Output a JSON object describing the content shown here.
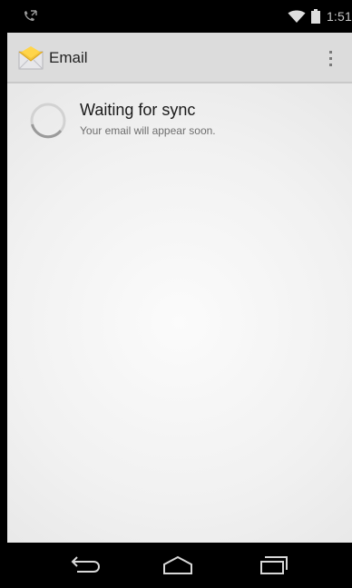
{
  "status_bar": {
    "time": "1:51",
    "icons": [
      "call-icon",
      "wifi-icon",
      "battery-icon"
    ]
  },
  "action_bar": {
    "title": "Email",
    "app_icon": "email-app-icon",
    "overflow_icon": "overflow-menu-icon"
  },
  "sync": {
    "title": "Waiting for sync",
    "subtitle": "Your email will appear soon.",
    "icon": "spinner-icon"
  },
  "nav_bar": {
    "buttons": [
      "back-icon",
      "home-icon",
      "recents-icon"
    ]
  },
  "colors": {
    "action_bar": "#dcdcdc",
    "status_bar": "#000000",
    "nav_bar": "#000000",
    "content": "#f4f4f4"
  }
}
